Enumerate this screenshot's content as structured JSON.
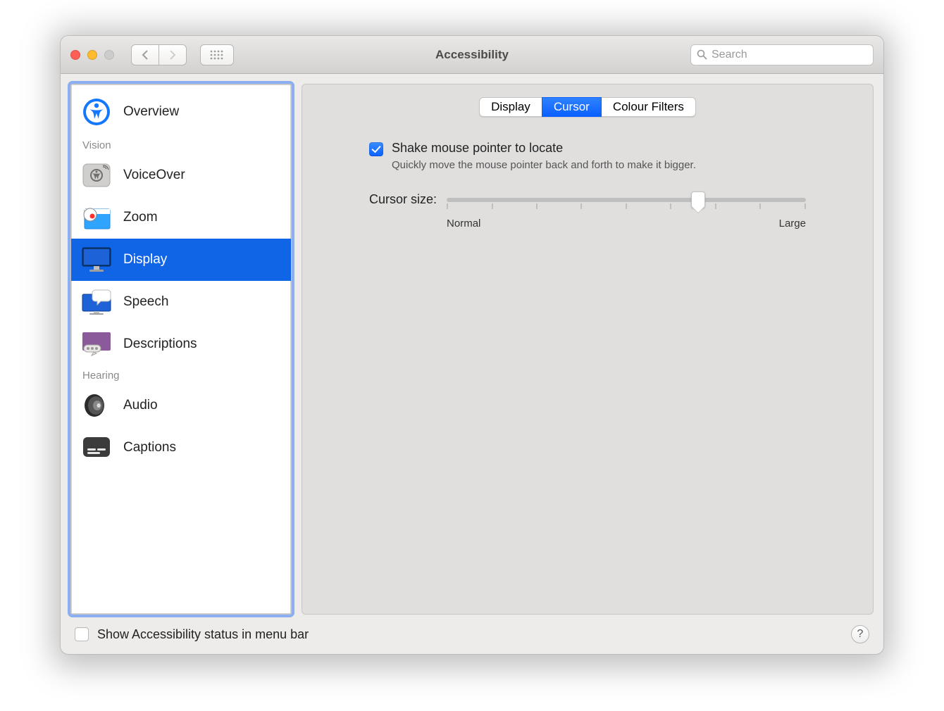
{
  "window": {
    "title": "Accessibility"
  },
  "search": {
    "placeholder": "Search"
  },
  "sidebar": {
    "sections": [
      {
        "heading": null,
        "items": [
          {
            "id": "overview",
            "label": "Overview",
            "selected": false
          }
        ]
      },
      {
        "heading": "Vision",
        "items": [
          {
            "id": "voiceover",
            "label": "VoiceOver",
            "selected": false
          },
          {
            "id": "zoom",
            "label": "Zoom",
            "selected": false
          },
          {
            "id": "display",
            "label": "Display",
            "selected": true
          },
          {
            "id": "speech",
            "label": "Speech",
            "selected": false
          },
          {
            "id": "descriptions",
            "label": "Descriptions",
            "selected": false
          }
        ]
      },
      {
        "heading": "Hearing",
        "items": [
          {
            "id": "audio",
            "label": "Audio",
            "selected": false
          },
          {
            "id": "captions",
            "label": "Captions",
            "selected": false
          }
        ]
      }
    ]
  },
  "tabs": {
    "items": [
      "Display",
      "Cursor",
      "Colour Filters"
    ],
    "active": 1
  },
  "shakeToLocate": {
    "checked": true,
    "title": "Shake mouse pointer to locate",
    "subtitle": "Quickly move the mouse pointer back and forth to make it bigger."
  },
  "cursorSize": {
    "label": "Cursor size:",
    "min_label": "Normal",
    "max_label": "Large",
    "value_fraction": 0.7,
    "ticks": 9
  },
  "footer": {
    "showStatus": {
      "checked": false,
      "label": "Show Accessibility status in menu bar"
    }
  },
  "helpTooltip": "?"
}
